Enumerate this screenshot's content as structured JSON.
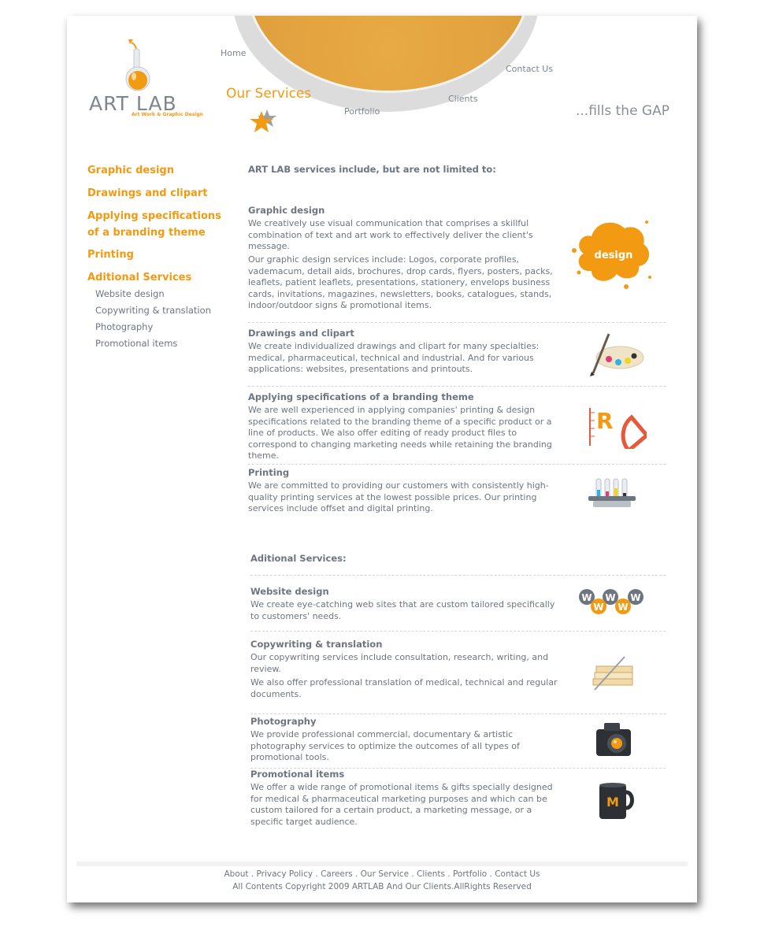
{
  "header": {
    "brand": "ART LAB",
    "brand_sub": "Art Work & Graphic Design",
    "tagline": "...fills the GAP",
    "nav": {
      "home": "Home",
      "our_services": "Our Services",
      "portfolio": "Portfolio",
      "clients": "Clients",
      "contact": "Contact Us"
    }
  },
  "sidebar": {
    "items": [
      "Graphic design",
      "Drawings and clipart",
      "Applying specifications of a branding theme",
      "Printing",
      "Aditional Services"
    ],
    "sub_items": [
      "Website design",
      "Copywriting & translation",
      "Photography",
      "Promotional items"
    ]
  },
  "main": {
    "intro": "ART LAB services include, but are not limited to:",
    "services": [
      {
        "title": "Graphic design",
        "text1": "We creatively use visual communication that comprises a skillful combination of text and art work to effectively deliver the client's message.",
        "text2": "Our graphic design services include: Logos, corporate profiles, vademacum, detail aids, brochures, drop cards, flyers, posters, packs, leaflets, patient leaflets, presentations, stationery, envelops business cards, invitations, magazines, newsletters, books, catalogues, stands, indoor/outdoor signs & promotional items.",
        "icon": "design-splash-icon",
        "icon_text": "design"
      },
      {
        "title": "Drawings and clipart",
        "text1": "We create individualized drawings and clipart for many specialties: medical, pharmaceutical, technical and industrial. And for various applications: websites, presentations and printouts.",
        "icon": "paint-palette-icon"
      },
      {
        "title": "Applying specifications of a branding theme",
        "text1": "We are well experienced in applying companies' printing & design specifications related to the branding theme of a specific product or a line of products. We also offer editing of ready product files to correspond to changing marketing needs while retaining the branding theme.",
        "icon": "ruler-protractor-icon",
        "icon_text": "R"
      },
      {
        "title": "Printing",
        "text1": "We are committed to providing our customers with consistently high-quality printing services at the lowest possible prices. Our printing services include offset and digital printing.",
        "icon": "ink-tubes-icon"
      }
    ],
    "additional_heading": "Aditional Services:",
    "additional": [
      {
        "title": "Website design",
        "text1": "We create eye-catching web sites that are custom tailored specifically to customers' needs.",
        "icon": "www-icon",
        "icon_text": "W"
      },
      {
        "title": "Copywriting & translation",
        "text1": "Our copywriting services include consultation, research, writing, and review.",
        "text2": "We also offer professional translation of medical, technical and regular documents.",
        "icon": "books-pen-icon"
      },
      {
        "title": "Photography",
        "text1": "We provide professional commercial, documentary & artistic photography services to optimize the outcomes of all types of promotional tools.",
        "icon": "camera-icon"
      },
      {
        "title": "Promotional items",
        "text1": "We offer a wide range of promotional items & gifts specially designed for medical & pharmaceutical marketing purposes and which can be custom tailored for a certain product, a marketing message, or a specific target audience.",
        "icon": "mug-icon",
        "icon_text": "M"
      }
    ]
  },
  "footer": {
    "links": [
      "About",
      "Privacy Policy",
      "Careers",
      "Our Service",
      "Clients",
      "Portfolio",
      "Contact Us"
    ],
    "copyright": "All Contents Copyright 2009 ARTLAB And Our Clients.AllRights Reserved"
  },
  "colors": {
    "accent": "#f29a12",
    "text": "#6d7580",
    "orb": "#e2a23f"
  }
}
